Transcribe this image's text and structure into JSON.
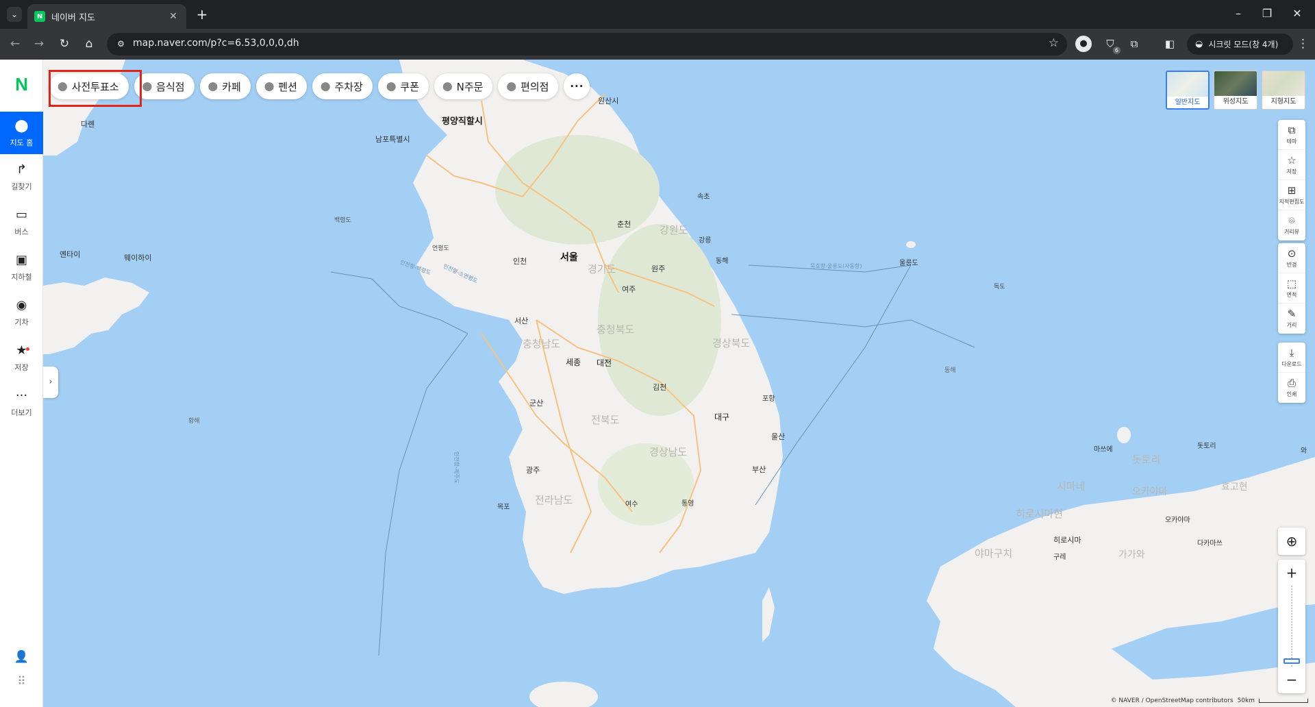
{
  "browser": {
    "tab_title": "네이버 지도",
    "tab_favicon": "N",
    "url": "map.naver.com/p?c=6.53,0,0,0,dh",
    "incognito_label": "시크릿 모드(창 4개)",
    "extension_badge": "6"
  },
  "sidebar": {
    "logo": "N",
    "items": [
      {
        "label": "지도 홈",
        "icon": "map-pin-icon"
      },
      {
        "label": "길찾기",
        "icon": "directions-icon"
      },
      {
        "label": "버스",
        "icon": "bus-icon"
      },
      {
        "label": "지하철",
        "icon": "subway-icon"
      },
      {
        "label": "기차",
        "icon": "train-icon"
      },
      {
        "label": "저장",
        "icon": "star-icon"
      },
      {
        "label": "더보기",
        "icon": "more-icon"
      }
    ]
  },
  "categories": [
    "사전투표소",
    "음식점",
    "카페",
    "펜션",
    "주차장",
    "쿠폰",
    "N주문",
    "편의점"
  ],
  "map_types": [
    "일반지도",
    "위성지도",
    "지형지도"
  ],
  "tools_group1": [
    "테마",
    "저장",
    "지적편집도",
    "거리뷰"
  ],
  "tools_group2": [
    "반경",
    "면적",
    "거리"
  ],
  "tools_group3": [
    "다운로드",
    "인쇄"
  ],
  "zoom": {
    "plus": "+",
    "minus": "−",
    "level_fraction": 0.93
  },
  "attribution": {
    "text": "© NAVER / OpenStreetMap contributors",
    "scale": "50km"
  },
  "map_labels": {
    "cities": [
      "평양직할시",
      "남포특별시",
      "원산시",
      "서울",
      "인천",
      "춘천",
      "강릉",
      "동해",
      "원주",
      "여주",
      "서산",
      "세종",
      "대전",
      "김천",
      "대구",
      "포항",
      "울산",
      "부산",
      "군산",
      "광주",
      "목포",
      "여수",
      "통영",
      "속초",
      "다롄",
      "옌타이",
      "웨이하이",
      "황히",
      "동해",
      "마쓰에",
      "돗토리",
      "히로시마",
      "오카야마",
      "다카마쓰",
      "구레",
      "울릉도",
      "독도",
      "백령도",
      "연평도"
    ],
    "regions": [
      "강원도",
      "경기도",
      "충청북도",
      "충청남도",
      "경상북도",
      "전북도",
      "경상남도",
      "전라남도",
      "시마네",
      "오카야마",
      "히로시마현",
      "돗토리",
      "효고현",
      "야마구치",
      "가가와",
      "와"
    ],
    "seas": [
      "황해",
      "동해"
    ],
    "routes": [
      "묵호항-울릉도(사동항)",
      "인천항-백령도",
      "인천항-소연평도",
      "인천항-제주도"
    ]
  }
}
